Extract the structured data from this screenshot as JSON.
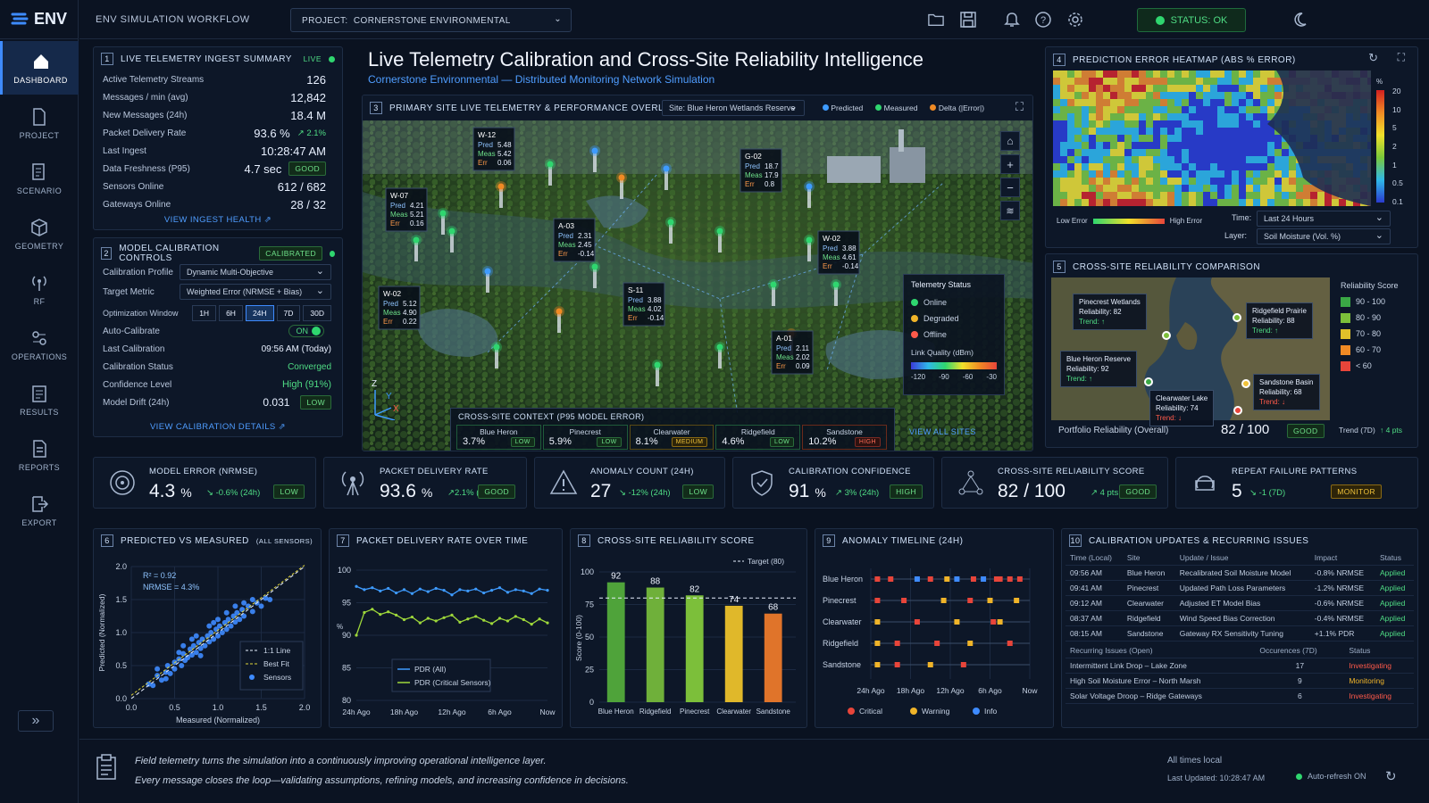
{
  "app": {
    "name": "ENV",
    "workflow": "ENV SIMULATION WORKFLOW",
    "project_label": "PROJECT:",
    "project": "CORNERSTONE ENVIRONMENTAL",
    "status": "STATUS: OK"
  },
  "nav": [
    {
      "label": "DASHBOARD",
      "icon": "home-icon"
    },
    {
      "label": "PROJECT",
      "icon": "document-icon"
    },
    {
      "label": "SCENARIO",
      "icon": "scenario-icon"
    },
    {
      "label": "GEOMETRY",
      "icon": "cube-icon"
    },
    {
      "label": "RF",
      "icon": "antenna-icon"
    },
    {
      "label": "OPERATIONS",
      "icon": "operations-icon"
    },
    {
      "label": "RESULTS",
      "icon": "clipboard-icon"
    },
    {
      "label": "REPORTS",
      "icon": "report-icon"
    },
    {
      "label": "EXPORT",
      "icon": "export-icon"
    }
  ],
  "title": "Live Telemetry Calibration and Cross-Site Reliability Intelligence",
  "subtitle": "Cornerstone Environmental — Distributed Monitoring Network Simulation",
  "p1": {
    "num": "1",
    "title": "LIVE TELEMETRY INGEST SUMMARY",
    "live": "LIVE",
    "rows": [
      [
        "Active Telemetry Streams",
        "126"
      ],
      [
        "Messages / min (avg)",
        "12,842"
      ],
      [
        "New Messages (24h)",
        "18.4 M"
      ],
      [
        "Packet Delivery Rate",
        "93.6 %"
      ],
      [
        "Last Ingest",
        "10:28:47 AM"
      ],
      [
        "Data Freshness (P95)",
        "4.7 sec"
      ],
      [
        "Sensors Online",
        "612 / 682"
      ],
      [
        "Gateways Online",
        "28 / 32"
      ]
    ],
    "pdr_delta": "↗ 2.1%",
    "fresh_badge": "GOOD",
    "link": "VIEW INGEST HEALTH"
  },
  "p2": {
    "num": "2",
    "title": "MODEL CALIBRATION CONTROLS",
    "badge": "CALIBRATED",
    "profile_label": "Calibration Profile",
    "profile": "Dynamic Multi-Objective",
    "metric_label": "Target Metric",
    "metric": "Weighted Error (NRMSE + Bias)",
    "window_label": "Optimization Window",
    "windows": [
      "1H",
      "6H",
      "24H",
      "7D",
      "30D"
    ],
    "auto_label": "Auto-Calibrate",
    "auto": "ON",
    "last_label": "Last Calibration",
    "last": "09:56 AM (Today)",
    "status_label": "Calibration Status",
    "status": "Converged",
    "conf_label": "Confidence Level",
    "conf": "High (91%)",
    "drift_label": "Model Drift (24h)",
    "drift": "0.031",
    "drift_badge": "LOW",
    "link": "VIEW CALIBRATION DETAILS"
  },
  "p3": {
    "num": "3",
    "title": "PRIMARY SITE LIVE TELEMETRY & PERFORMANCE OVERLAY",
    "site": "Site: Blue Heron Wetlands Reserve",
    "legend": [
      "Predicted",
      "Measured",
      "Delta (|Error|)"
    ],
    "callouts": [
      {
        "id": "W-12",
        "pred": "5.48",
        "meas": "5.42",
        "err": "0.06"
      },
      {
        "id": "G-02",
        "pred": "18.7",
        "meas": "17.9",
        "err": "0.8"
      },
      {
        "id": "W-07",
        "pred": "4.21",
        "meas": "5.21",
        "err": "0.16"
      },
      {
        "id": "A-03",
        "pred": "2.31",
        "meas": "2.45",
        "err": "-0.14"
      },
      {
        "id": "W-02",
        "pred": "3.88",
        "meas": "4.61",
        "err": "-0.14"
      },
      {
        "id": "S-11",
        "pred": "3.88",
        "meas": "4.02",
        "err": "-0.14"
      },
      {
        "id": "W-02",
        "pred": "5.12",
        "meas": "4.90",
        "err": "0.22"
      },
      {
        "id": "A-01",
        "pred": "2.11",
        "meas": "2.02",
        "err": "0.09"
      }
    ],
    "labels": {
      "pred": "Pred",
      "meas": "Meas",
      "err": "Err"
    },
    "tstatus": {
      "title": "Telemetry Status",
      "items": [
        "Online",
        "Degraded",
        "Offline"
      ],
      "lq": "Link Quality (dBm)",
      "ticks": [
        "-120",
        "-90",
        "-60",
        "-30"
      ]
    },
    "context": {
      "title": "CROSS-SITE CONTEXT (P95 MODEL ERROR)",
      "sites": [
        {
          "name": "Blue Heron",
          "val": "3.7%",
          "badge": "LOW"
        },
        {
          "name": "Pinecrest",
          "val": "5.9%",
          "badge": "LOW"
        },
        {
          "name": "Clearwater",
          "val": "8.1%",
          "badge": "MEDIUM"
        },
        {
          "name": "Ridgefield",
          "val": "4.6%",
          "badge": "LOW"
        },
        {
          "name": "Sandstone",
          "val": "10.2%",
          "badge": "HIGH"
        }
      ],
      "link": "VIEW ALL SITES"
    },
    "axes": [
      "Z",
      "Y",
      "X"
    ]
  },
  "p4": {
    "num": "4",
    "title": "PREDICTION ERROR HEATMAP (ABS % ERROR)",
    "unit": "%",
    "ticks": [
      "20",
      "10",
      "5",
      "2",
      "1",
      "0.5",
      "0.1"
    ],
    "low": "Low Error",
    "high": "High Error",
    "time_label": "Time:",
    "time": "Last 24 Hours",
    "layer_label": "Layer:",
    "layer": "Soil Moisture (Vol. %)"
  },
  "p5": {
    "num": "5",
    "title": "CROSS-SITE RELIABILITY COMPARISON",
    "sites": [
      {
        "name": "Pinecrest Wetlands",
        "rel": "Reliability: 82",
        "trend": "Trend: ↑"
      },
      {
        "name": "Ridgefield Prairie",
        "rel": "Reliability: 88",
        "trend": "Trend: ↑"
      },
      {
        "name": "Blue Heron Reserve",
        "rel": "Reliability: 92",
        "trend": "Trend: ↑"
      },
      {
        "name": "Sandstone Basin",
        "rel": "Reliability: 68",
        "trend": "Trend: ↓"
      },
      {
        "name": "Clearwater Lake",
        "rel": "Reliability: 74",
        "trend": "Trend: ↓"
      }
    ],
    "legend_title": "Reliability Score",
    "legend": [
      {
        "label": "90 - 100",
        "color": "#3aa845"
      },
      {
        "label": "80 - 90",
        "color": "#7cbf3a"
      },
      {
        "label": "70 - 80",
        "color": "#e0c12a"
      },
      {
        "label": "60 - 70",
        "color": "#f08a24"
      },
      {
        "label": "< 60",
        "color": "#e8453a"
      }
    ],
    "overall_label": "Portfolio Reliability (Overall)",
    "overall": "82 / 100",
    "overall_badge": "GOOD",
    "trend": "Trend (7D)",
    "trend_val": "↑ 4 pts"
  },
  "kpis": [
    {
      "label": "MODEL ERROR (NRMSE)",
      "value": "4.3",
      "unit": "%",
      "delta": "↘ -0.6% (24h)",
      "badge": "LOW",
      "icon": "target-icon"
    },
    {
      "label": "PACKET DELIVERY RATE",
      "value": "93.6",
      "unit": "%",
      "delta": "↗2.1% (24h)",
      "badge": "GOOD",
      "icon": "antenna-icon"
    },
    {
      "label": "ANOMALY COUNT (24H)",
      "value": "27",
      "unit": "",
      "delta": "↘ -12% (24h)",
      "badge": "LOW",
      "icon": "warning-icon"
    },
    {
      "label": "CALIBRATION CONFIDENCE",
      "value": "91",
      "unit": "%",
      "delta": "↗ 3% (24h)",
      "badge": "HIGH",
      "icon": "shield-icon"
    },
    {
      "label": "CROSS-SITE RELIABILITY SCORE",
      "value": "82 / 100",
      "unit": "",
      "delta": "↗ 4 pts (7D)",
      "badge": "GOOD",
      "icon": "network-icon"
    },
    {
      "label": "REPEAT FAILURE PATTERNS",
      "value": "5",
      "unit": "",
      "delta": "↘ -1 (7D)",
      "badge": "MONITOR",
      "icon": "cycle-icon"
    }
  ],
  "p6": {
    "num": "6",
    "title": "PREDICTED vs MEASURED",
    "title_small": "(ALL SENSORS)",
    "r2": "R² = 0.92",
    "nrmse": "NRMSE = 4.3%",
    "legend": [
      "1:1 Line",
      "Best Fit",
      "Sensors"
    ]
  },
  "p7": {
    "num": "7",
    "title": "PACKET DELIVERY RATE OVER TIME"
  },
  "p8": {
    "num": "8",
    "title": "CROSS-SITE RELIABILITY SCORE",
    "target": "Target (80)"
  },
  "p9": {
    "num": "9",
    "title": "ANOMALY TIMELINE (24H)",
    "legend": [
      "Critical",
      "Warning",
      "Info"
    ]
  },
  "p10": {
    "num": "10",
    "title": "CALIBRATION UPDATES & RECURRING ISSUES",
    "headers": [
      "Time (Local)",
      "Site",
      "Update / Issue",
      "Impact",
      "Status"
    ],
    "rows": [
      [
        "09:56 AM",
        "Blue Heron",
        "Recalibrated Soil Moisture Model",
        "-0.8% NRMSE",
        "Applied"
      ],
      [
        "09:41 AM",
        "Pinecrest",
        "Updated Path Loss Parameters",
        "-1.2% NRMSE",
        "Applied"
      ],
      [
        "09:12 AM",
        "Clearwater",
        "Adjusted ET Model Bias",
        "-0.6% NRMSE",
        "Applied"
      ],
      [
        "08:37 AM",
        "Ridgefield",
        "Wind Speed Bias Correction",
        "-0.4% NRMSE",
        "Applied"
      ],
      [
        "08:15 AM",
        "Sandstone",
        "Gateway RX Sensitivity Tuning",
        "+1.1% PDR",
        "Applied"
      ]
    ],
    "rec_headers": [
      "Recurring Issues (Open)",
      "Occurences (7D)",
      "Status"
    ],
    "rec": [
      [
        "Intermittent Link Drop – Lake Zone",
        "17",
        "Investigating"
      ],
      [
        "High Soil Moisture Error – North Marsh",
        "9",
        "Monitoring"
      ],
      [
        "Solar Voltage Droop – Ridge Gateways",
        "6",
        "Investigating"
      ]
    ]
  },
  "footer": {
    "line1": "Field telemetry turns the simulation into a continuously improving operational intelligence layer.",
    "line2": "Every message closes the loop—validating assumptions, refining models, and increasing confidence in decisions.",
    "times": "All times local",
    "updated": "Last Updated: 10:28:47 AM",
    "refresh": "Auto-refresh ON"
  },
  "chart_data": [
    {
      "type": "scatter",
      "title": "PREDICTED vs MEASURED",
      "xlabel": "Measured (Normalized)",
      "ylabel": "Predicted (Normalized)",
      "xlim": [
        0,
        2
      ],
      "ylim": [
        0,
        2
      ],
      "xticks": [
        "0.0",
        "0.5",
        "1.0",
        "1.5",
        "2.0"
      ],
      "yticks": [
        "0.0",
        "0.5",
        "1.0",
        "1.5",
        "2.0"
      ],
      "r2": 0.92,
      "points": [
        [
          0.2,
          0.22
        ],
        [
          0.25,
          0.2
        ],
        [
          0.3,
          0.35
        ],
        [
          0.35,
          0.28
        ],
        [
          0.4,
          0.4
        ],
        [
          0.42,
          0.5
        ],
        [
          0.45,
          0.38
        ],
        [
          0.5,
          0.55
        ],
        [
          0.5,
          0.45
        ],
        [
          0.55,
          0.6
        ],
        [
          0.58,
          0.5
        ],
        [
          0.6,
          0.68
        ],
        [
          0.62,
          0.58
        ],
        [
          0.65,
          0.62
        ],
        [
          0.68,
          0.75
        ],
        [
          0.7,
          0.66
        ],
        [
          0.72,
          0.8
        ],
        [
          0.75,
          0.7
        ],
        [
          0.78,
          0.85
        ],
        [
          0.8,
          0.76
        ],
        [
          0.82,
          0.9
        ],
        [
          0.85,
          0.8
        ],
        [
          0.88,
          0.95
        ],
        [
          0.9,
          0.86
        ],
        [
          0.92,
          1.0
        ],
        [
          0.95,
          0.9
        ],
        [
          0.98,
          1.05
        ],
        [
          1.0,
          0.95
        ],
        [
          1.02,
          1.1
        ],
        [
          1.05,
          1.0
        ],
        [
          1.08,
          1.15
        ],
        [
          1.1,
          1.05
        ],
        [
          1.12,
          1.2
        ],
        [
          1.15,
          1.1
        ],
        [
          1.18,
          1.25
        ],
        [
          1.2,
          1.16
        ],
        [
          1.22,
          1.3
        ],
        [
          1.25,
          1.2
        ],
        [
          1.28,
          1.35
        ],
        [
          1.3,
          1.25
        ],
        [
          1.35,
          1.4
        ],
        [
          1.4,
          1.32
        ],
        [
          1.45,
          1.45
        ],
        [
          1.5,
          1.4
        ],
        [
          1.55,
          1.52
        ],
        [
          1.6,
          1.5
        ],
        [
          0.7,
          0.9
        ],
        [
          0.9,
          1.1
        ],
        [
          1.1,
          1.3
        ],
        [
          0.6,
          0.8
        ],
        [
          1.3,
          1.45
        ],
        [
          0.8,
          0.65
        ],
        [
          1.0,
          1.2
        ],
        [
          0.4,
          0.3
        ],
        [
          0.3,
          0.45
        ],
        [
          1.2,
          1.4
        ],
        [
          1.4,
          1.5
        ],
        [
          0.55,
          0.7
        ],
        [
          0.75,
          0.95
        ],
        [
          0.95,
          1.15
        ]
      ]
    },
    {
      "type": "line",
      "title": "PACKET DELIVERY RATE OVER TIME",
      "ylabel": "%",
      "ylim": [
        80,
        100
      ],
      "yticks": [
        "100",
        "95",
        "90",
        "85",
        "80"
      ],
      "xticks": [
        "24h Ago",
        "18h Ago",
        "12h Ago",
        "6h Ago",
        "Now"
      ],
      "series": [
        {
          "name": "PDR (All)",
          "color": "#3e9bff",
          "values": [
            97.5,
            97.0,
            97.3,
            96.8,
            97.2,
            96.5,
            97.0,
            96.4,
            97.1,
            96.7,
            97.2,
            96.9,
            96.2,
            97.0,
            96.8,
            97.1,
            96.5,
            96.9,
            97.3,
            96.6,
            97.0,
            96.8,
            96.4,
            97.1,
            96.9
          ]
        },
        {
          "name": "PDR (Critical Sensors)",
          "color": "#9ed83a",
          "values": [
            90.0,
            93.5,
            94.0,
            93.2,
            93.6,
            93.1,
            92.4,
            92.8,
            91.9,
            92.6,
            92.2,
            92.7,
            93.1,
            92.0,
            92.5,
            92.9,
            92.3,
            91.8,
            92.6,
            92.2,
            92.9,
            92.4,
            91.7,
            92.5,
            91.9
          ]
        }
      ]
    },
    {
      "type": "bar",
      "title": "CROSS-SITE RELIABILITY SCORE",
      "ylabel": "Score (0-100)",
      "ylim": [
        0,
        100
      ],
      "yticks": [
        "100",
        "75",
        "50",
        "25",
        "0"
      ],
      "categories": [
        "Blue Heron",
        "Ridgefield",
        "Pinecrest",
        "Clearwater",
        "Sandstone"
      ],
      "values": [
        92,
        88,
        82,
        74,
        68
      ],
      "colors": [
        "#4fa33a",
        "#6fb03a",
        "#7cbf3a",
        "#e0b82a",
        "#e0742a"
      ],
      "target": 80
    },
    {
      "type": "scatter",
      "title": "ANOMALY TIMELINE (24H)",
      "categories": [
        "Blue Heron",
        "Pinecrest",
        "Clearwater",
        "Ridgefield",
        "Sandstone"
      ],
      "xticks": [
        "24h Ago",
        "18h Ago",
        "12h Ago",
        "6h Ago",
        "Now"
      ],
      "xlim": [
        24,
        0
      ],
      "events": [
        {
          "site": 0,
          "t": 23,
          "lvl": "c"
        },
        {
          "site": 0,
          "t": 21,
          "lvl": "c"
        },
        {
          "site": 0,
          "t": 17,
          "lvl": "i"
        },
        {
          "site": 0,
          "t": 15,
          "lvl": "c"
        },
        {
          "site": 0,
          "t": 12.5,
          "lvl": "w"
        },
        {
          "site": 0,
          "t": 11,
          "lvl": "i"
        },
        {
          "site": 0,
          "t": 8.5,
          "lvl": "c"
        },
        {
          "site": 0,
          "t": 7,
          "lvl": "i"
        },
        {
          "site": 0,
          "t": 5,
          "lvl": "c"
        },
        {
          "site": 0,
          "t": 4.5,
          "lvl": "c"
        },
        {
          "site": 0,
          "t": 3,
          "lvl": "c"
        },
        {
          "site": 0,
          "t": 1.5,
          "lvl": "c"
        },
        {
          "site": 1,
          "t": 23,
          "lvl": "c"
        },
        {
          "site": 1,
          "t": 19,
          "lvl": "c"
        },
        {
          "site": 1,
          "t": 13,
          "lvl": "w"
        },
        {
          "site": 1,
          "t": 9,
          "lvl": "c"
        },
        {
          "site": 1,
          "t": 6,
          "lvl": "w"
        },
        {
          "site": 1,
          "t": 2,
          "lvl": "w"
        },
        {
          "site": 2,
          "t": 23,
          "lvl": "w"
        },
        {
          "site": 2,
          "t": 17,
          "lvl": "c"
        },
        {
          "site": 2,
          "t": 11,
          "lvl": "w"
        },
        {
          "site": 2,
          "t": 5.5,
          "lvl": "c"
        },
        {
          "site": 2,
          "t": 4.5,
          "lvl": "w"
        },
        {
          "site": 3,
          "t": 23,
          "lvl": "w"
        },
        {
          "site": 3,
          "t": 20,
          "lvl": "c"
        },
        {
          "site": 3,
          "t": 14,
          "lvl": "c"
        },
        {
          "site": 3,
          "t": 9,
          "lvl": "w"
        },
        {
          "site": 3,
          "t": 3,
          "lvl": "c"
        },
        {
          "site": 4,
          "t": 23,
          "lvl": "w"
        },
        {
          "site": 4,
          "t": 20,
          "lvl": "c"
        },
        {
          "site": 4,
          "t": 15,
          "lvl": "w"
        },
        {
          "site": 4,
          "t": 10,
          "lvl": "c"
        }
      ]
    }
  ]
}
